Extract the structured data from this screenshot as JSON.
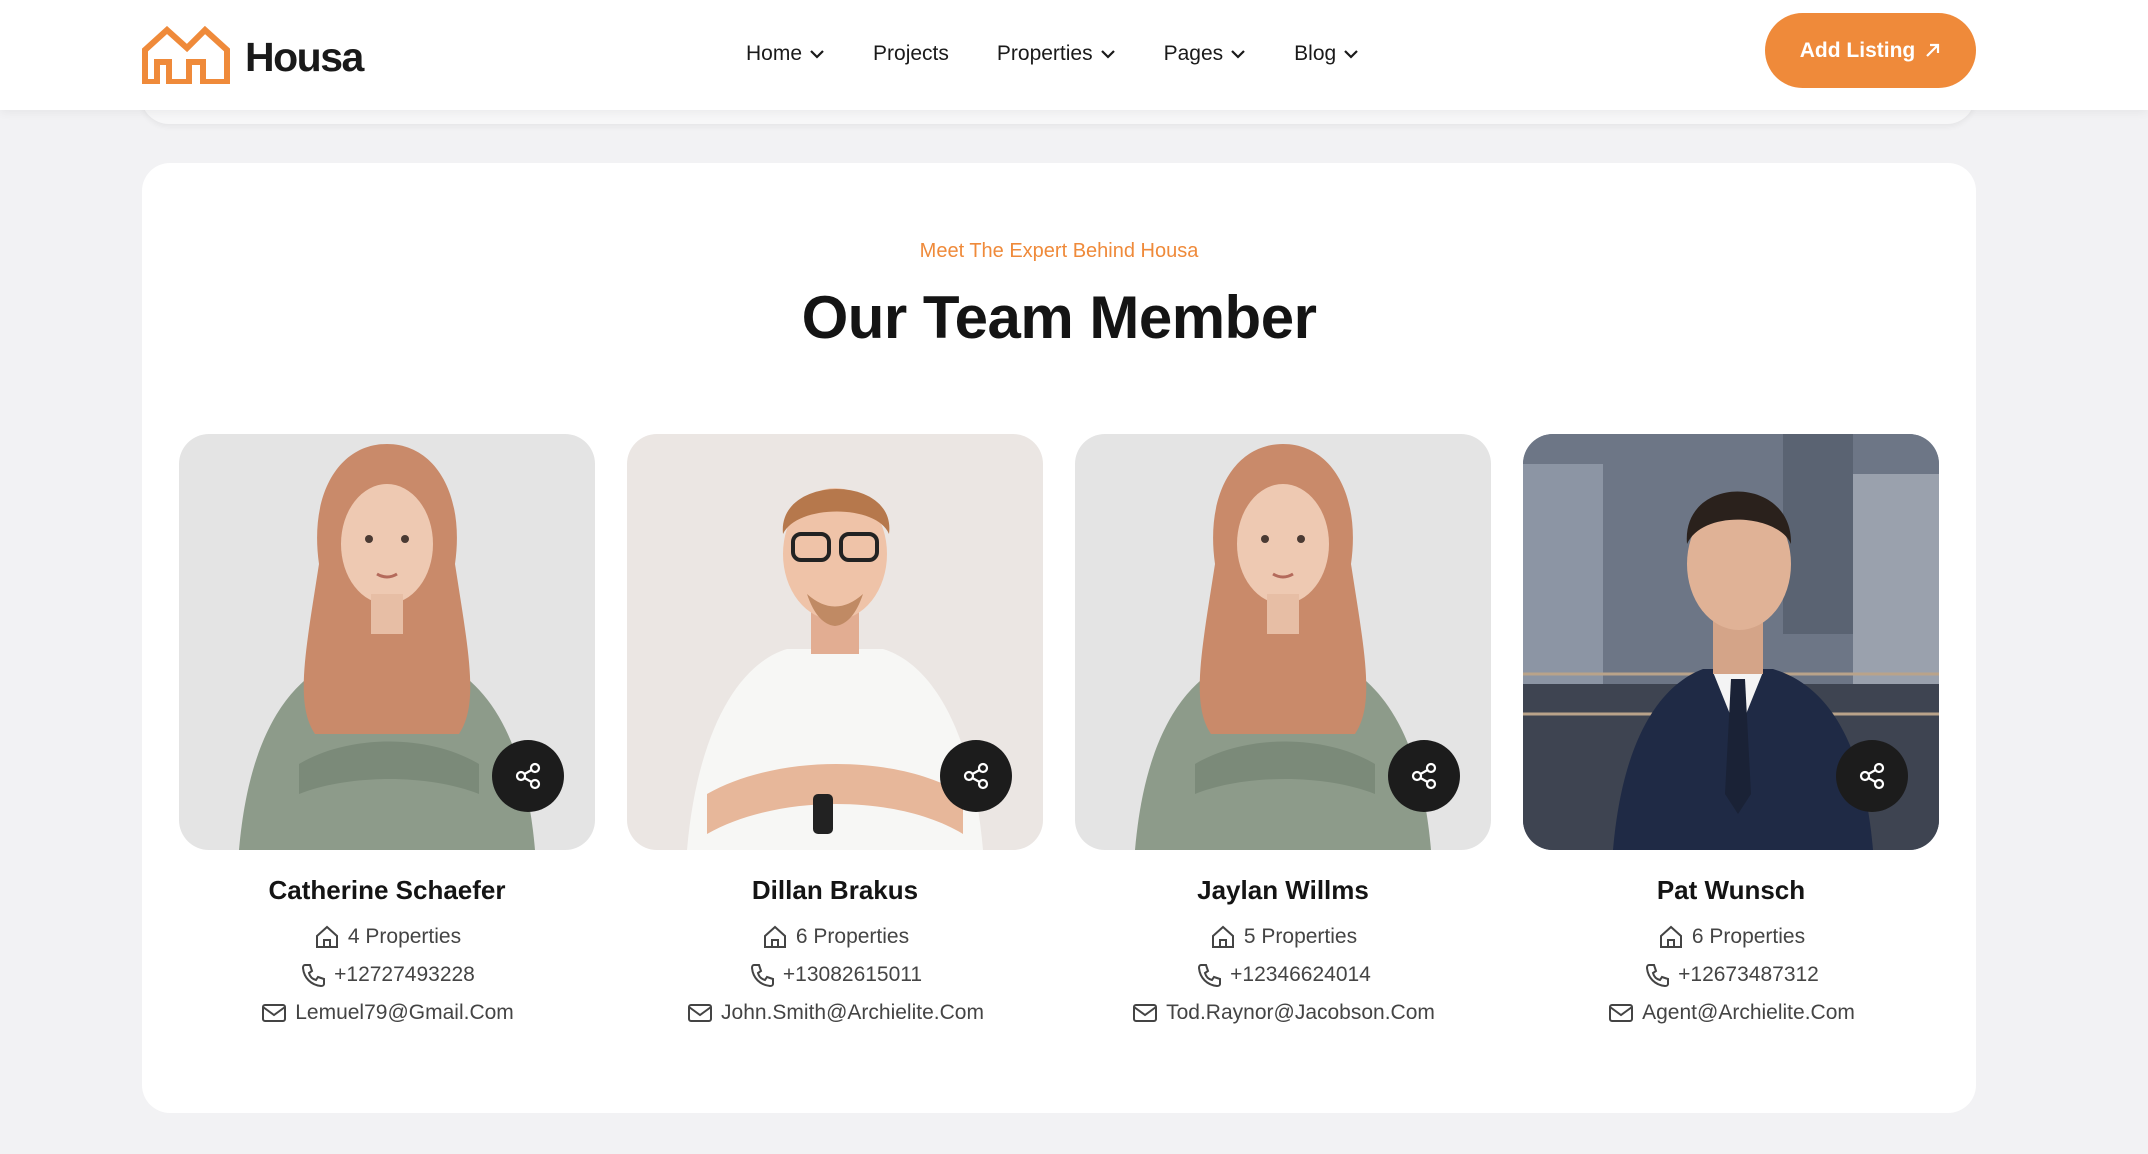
{
  "brand": {
    "name": "Housa",
    "accent": "#ef8a3a",
    "logo_icon": "house-outline-icon"
  },
  "nav": {
    "items": [
      {
        "label": "Home",
        "has_dropdown": true
      },
      {
        "label": "Projects",
        "has_dropdown": false
      },
      {
        "label": "Properties",
        "has_dropdown": true
      },
      {
        "label": "Pages",
        "has_dropdown": true
      },
      {
        "label": "Blog",
        "has_dropdown": true
      }
    ],
    "cta_label": "Add Listing",
    "cta_icon": "arrow-up-right-icon"
  },
  "section": {
    "eyebrow": "Meet The Expert Behind Housa",
    "title": "Our Team Member"
  },
  "team": [
    {
      "name": "Catherine Schaefer",
      "properties": "4 Properties",
      "phone": "+12727493228",
      "email": "Lemuel79@Gmail.Com",
      "photo": "woman-portrait",
      "background": "#e4e4e4"
    },
    {
      "name": "Dillan Brakus",
      "properties": "6 Properties",
      "phone": "+13082615011",
      "email": "John.Smith@Archielite.Com",
      "photo": "man-glasses-portrait",
      "background": "#ebe6e3"
    },
    {
      "name": "Jaylan Willms",
      "properties": "5 Properties",
      "phone": "+12346624014",
      "email": "Tod.Raynor@Jacobson.Com",
      "photo": "woman-portrait",
      "background": "#e4e4e4"
    },
    {
      "name": "Pat Wunsch",
      "properties": "6 Properties",
      "phone": "+12673487312",
      "email": "Agent@Archielite.Com",
      "photo": "man-suit-city-portrait",
      "background": "#7c8596"
    }
  ],
  "icons": {
    "share": "share-icon",
    "home": "home-icon",
    "phone": "phone-icon",
    "mail": "mail-icon"
  }
}
